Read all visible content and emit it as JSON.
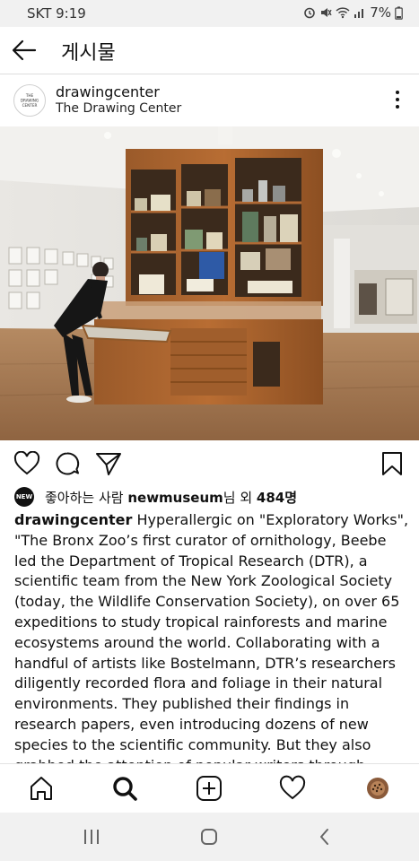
{
  "status_bar": {
    "carrier_time": "SKT 9:19",
    "battery": "7%"
  },
  "header": {
    "title": "게시물"
  },
  "post": {
    "username": "drawingcenter",
    "display_name": "The Drawing Center",
    "avatar_label": "THE DRAWING CENTER",
    "likes": {
      "avatar_label": "NEW",
      "prefix": "좋아하는 사람 ",
      "user": "newmuseum",
      "middle": "님 외 ",
      "count": "484명"
    },
    "caption": {
      "username": "drawingcenter",
      "text": "Hyperallergic on \"Exploratory Works\", \"The Bronx Zoo’s first curator of ornithology, Beebe led the Department of Tropical Research (DTR), a scientific team from the New York Zoological Society (today, the Wildlife Conservation Society), on over 65 expeditions to study tropical rainforests and marine ecosystems around the world. Collaborating with a handful of artists like Bostelmann, DTR’s researchers diligently recorded flora and foliage in their natural environments. They published their findings in research papers, even introducing dozens of new species to the scientific community. But they also grabbed the attention of popular writers through captivating lectures, media"
    }
  },
  "colors": {
    "icon": "#111111",
    "muted": "#777777",
    "status_bg": "#f1f1f1"
  }
}
